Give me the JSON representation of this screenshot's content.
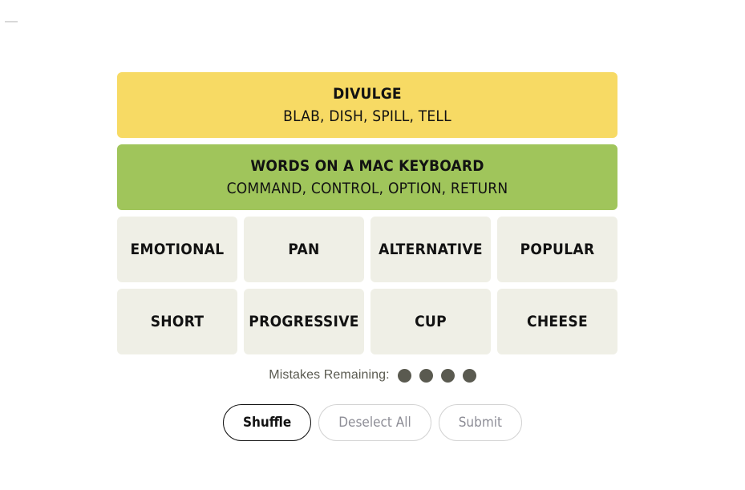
{
  "game": {
    "solved_groups": [
      {
        "title": "DIVULGE",
        "words_line": "BLAB, DISH, SPILL, TELL",
        "color": "#F7DA64",
        "difficulty": "yellow"
      },
      {
        "title": "WORDS ON A MAC KEYBOARD",
        "words_line": "COMMAND, CONTROL, OPTION, RETURN",
        "color": "#A0C55B",
        "difficulty": "green"
      }
    ],
    "tile_color": "#EFEFE6",
    "tile_rows": [
      [
        "EMOTIONAL",
        "PAN",
        "ALTERNATIVE",
        "POPULAR"
      ],
      [
        "SHORT",
        "PROGRESSIVE",
        "CUP",
        "CHEESE"
      ]
    ],
    "mistakes": {
      "label": "Mistakes Remaining:",
      "remaining": 4,
      "dot_color": "#5A5A50"
    },
    "buttons": [
      {
        "label": "Shuffle",
        "style": "primary"
      },
      {
        "label": "Deselect All",
        "style": "muted"
      },
      {
        "label": "Submit",
        "style": "muted"
      }
    ]
  }
}
